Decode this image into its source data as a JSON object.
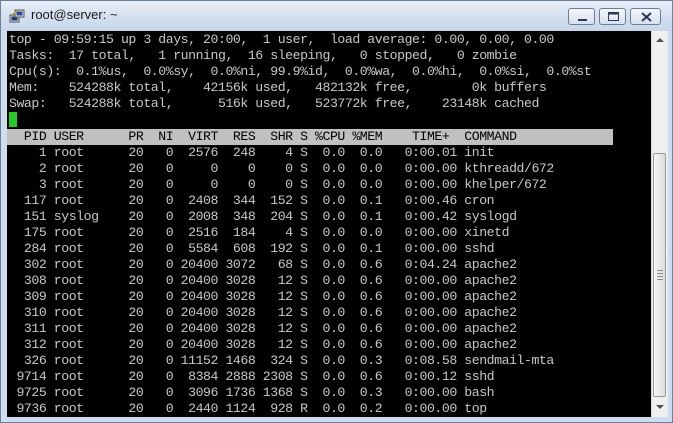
{
  "window": {
    "title": "root@server: ~"
  },
  "summary": [
    "top - 09:59:15 up 3 days, 20:00,  1 user,  load average: 0.00, 0.00, 0.00",
    "Tasks:  17 total,   1 running,  16 sleeping,   0 stopped,   0 zombie",
    "Cpu(s):  0.1%us,  0.0%sy,  0.0%ni, 99.9%id,  0.0%wa,  0.0%hi,  0.0%si,  0.0%st",
    "Mem:    524288k total,    42156k used,   482132k free,        0k buffers",
    "Swap:   524288k total,      516k used,   523772k free,    23148k cached"
  ],
  "process_table": {
    "header": "  PID USER      PR  NI  VIRT  RES  SHR S %CPU %MEM    TIME+  COMMAND",
    "rows": [
      "    1 root      20   0  2576  248    4 S  0.0  0.0   0:00.01 init",
      "    2 root      20   0     0    0    0 S  0.0  0.0   0:00.00 kthreadd/672",
      "    3 root      20   0     0    0    0 S  0.0  0.0   0:00.00 khelper/672",
      "  117 root      20   0  2408  344  152 S  0.0  0.1   0:00.46 cron",
      "  151 syslog    20   0  2008  348  204 S  0.0  0.1   0:00.42 syslogd",
      "  175 root      20   0  2516  184    4 S  0.0  0.0   0:00.00 xinetd",
      "  284 root      20   0  5584  608  192 S  0.0  0.1   0:00.00 sshd",
      "  302 root      20   0 20400 3072   68 S  0.0  0.6   0:04.24 apache2",
      "  308 root      20   0 20400 3028   12 S  0.0  0.6   0:00.00 apache2",
      "  309 root      20   0 20400 3028   12 S  0.0  0.6   0:00.00 apache2",
      "  310 root      20   0 20400 3028   12 S  0.0  0.6   0:00.00 apache2",
      "  311 root      20   0 20400 3028   12 S  0.0  0.6   0:00.00 apache2",
      "  312 root      20   0 20400 3028   12 S  0.0  0.6   0:00.00 apache2",
      "  326 root      20   0 11152 1468  324 S  0.0  0.3   0:08.58 sendmail-mta",
      " 9714 root      20   0  8384 2888 2308 S  0.0  0.6   0:00.12 sshd",
      " 9725 root      20   0  3096 1736 1368 S  0.0  0.3   0:00.00 bash",
      " 9736 root      20   0  2440 1124  928 R  0.0  0.2   0:00.00 top"
    ]
  },
  "colors": {
    "terminal_bg": "#000000",
    "text": "#c8c8c8",
    "header_bar": "#c0c0c0",
    "cursor": "#28c828"
  },
  "icons": {
    "app": "putty-icon",
    "minimize": "minimize-icon",
    "maximize": "maximize-icon",
    "close": "close-icon"
  }
}
